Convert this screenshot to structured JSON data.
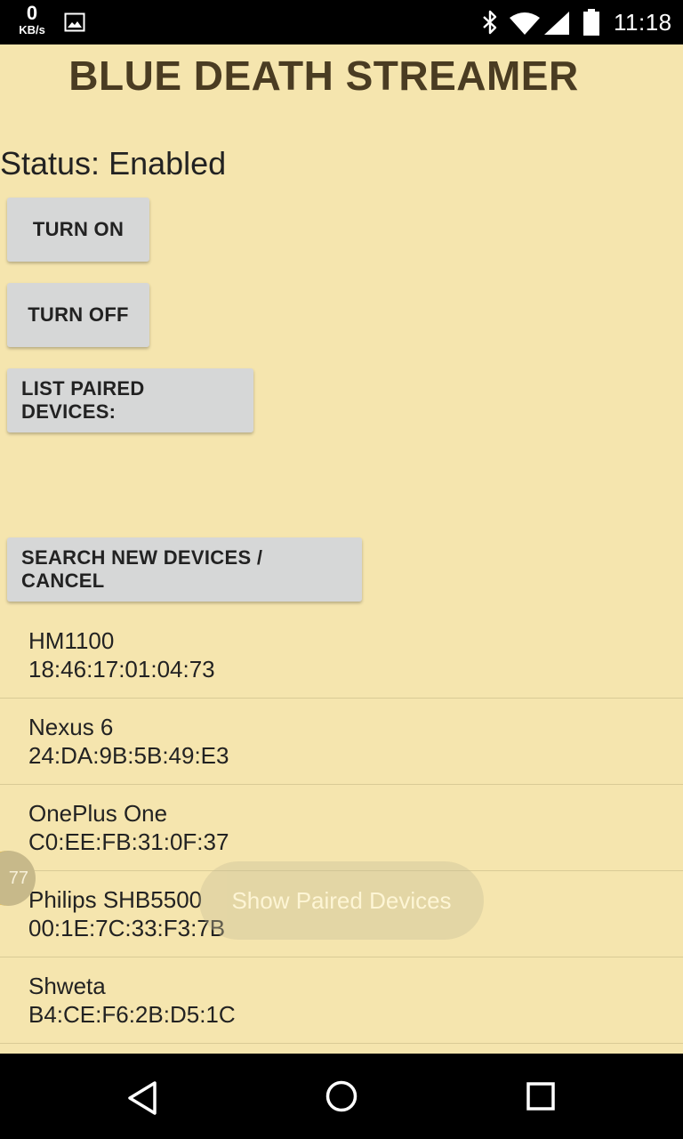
{
  "status_bar": {
    "net_speed_value": "0",
    "net_speed_unit": "KB/s",
    "time": "11:18",
    "icons": [
      "image-icon",
      "bluetooth-icon",
      "wifi-icon",
      "signal-icon",
      "battery-icon"
    ]
  },
  "app": {
    "title": "BLUE DEATH STREAMER",
    "status": "Status: Enabled"
  },
  "buttons": {
    "turn_on": "TURN ON",
    "turn_off": "TURN OFF",
    "list_paired": "LIST PAIRED DEVICES:",
    "search": "SEARCH NEW DEVICES / CANCEL"
  },
  "devices": [
    {
      "name": "HM1100",
      "address": "18:46:17:01:04:73"
    },
    {
      "name": "Nexus 6",
      "address": "24:DA:9B:5B:49:E3"
    },
    {
      "name": "OnePlus One",
      "address": "C0:EE:FB:31:0F:37"
    },
    {
      "name": "Philips SHB5500",
      "address": "00:1E:7C:33:F3:7B"
    },
    {
      "name": "Shweta",
      "address": "B4:CE:F6:2B:D5:1C"
    }
  ],
  "toast": "Show Paired Devices",
  "side_bubble": "77",
  "colors": {
    "background": "#f5e5ae",
    "title": "#4a3c22",
    "button": "#d6d7d7"
  }
}
